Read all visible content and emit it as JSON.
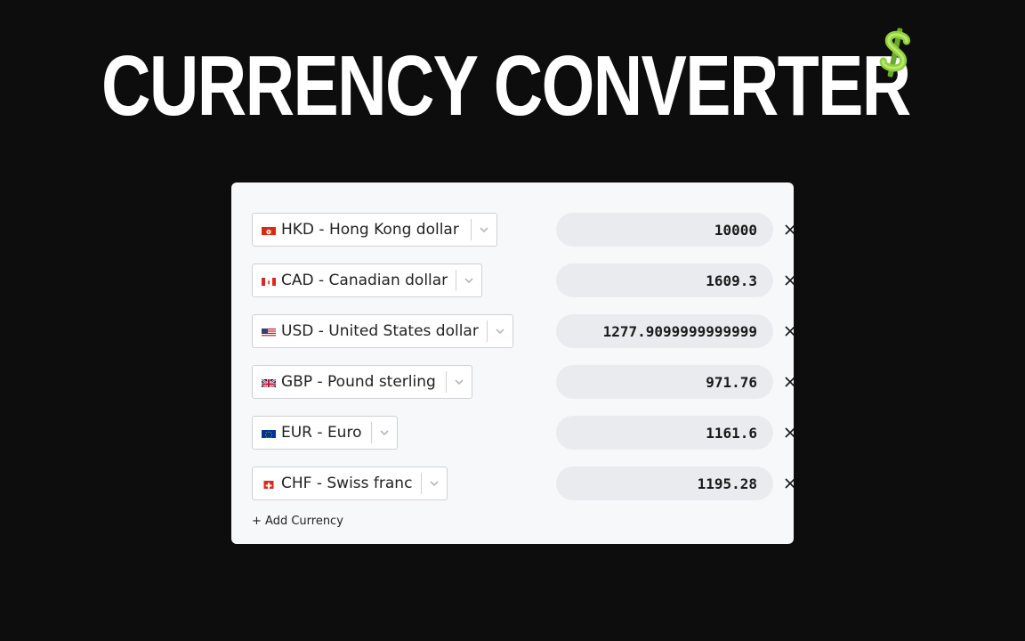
{
  "header": {
    "title": "CURRENCY CONVERTER",
    "title_color": "#ffffff",
    "icon": "dollar-sign-icon",
    "icon_color": "#8fcf3c"
  },
  "converter": {
    "rows": [
      {
        "code": "HKD",
        "label": "HKD - Hong Kong dollar",
        "flag": "hong-kong-flag-icon",
        "amount": "10000"
      },
      {
        "code": "CAD",
        "label": "CAD - Canadian dollar",
        "flag": "canada-flag-icon",
        "amount": "1609.3"
      },
      {
        "code": "USD",
        "label": "USD - United States dollar",
        "flag": "united-states-flag-icon",
        "amount": "1277.9099999999999"
      },
      {
        "code": "GBP",
        "label": "GBP - Pound sterling",
        "flag": "united-kingdom-flag-icon",
        "amount": "971.76"
      },
      {
        "code": "EUR",
        "label": "EUR - Euro",
        "flag": "european-union-flag-icon",
        "amount": "1161.6"
      },
      {
        "code": "CHF",
        "label": "CHF - Swiss franc",
        "flag": "switzerland-flag-icon",
        "amount": "1195.28"
      }
    ],
    "remove_icon": "close-icon",
    "dropdown_icon": "chevron-down-icon",
    "add_label": "+ Add Currency"
  },
  "colors": {
    "background": "#0d0d0d",
    "card": "#f7f8fa",
    "amount_field": "#eaebef",
    "border": "#cfd1d4"
  }
}
